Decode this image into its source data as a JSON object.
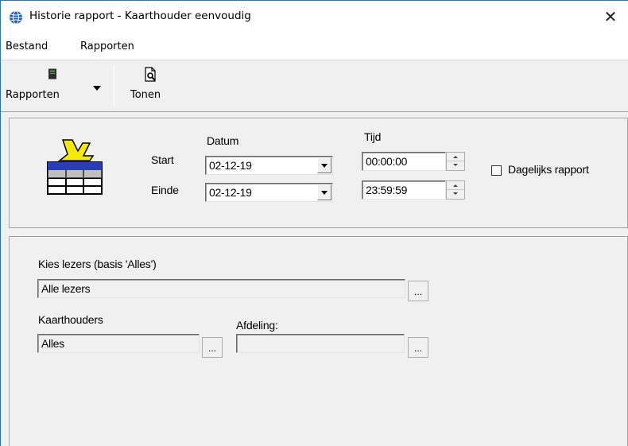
{
  "window": {
    "title": "Historie rapport - Kaarthouder eenvoudig",
    "close_glyph": "✕",
    "accent_color": "#2b73c8"
  },
  "menu": {
    "items": [
      "Bestand",
      "Rapporten"
    ]
  },
  "toolbar": {
    "reports_label": "Rapporten",
    "show_label": "Tonen"
  },
  "period": {
    "date_header": "Datum",
    "time_header": "Tijd",
    "start_label": "Start",
    "end_label": "Einde",
    "start_date": "02-12-19",
    "end_date": "02-12-19",
    "start_time": "00:00:00",
    "end_time": "23:59:59",
    "daily_report_label": "Dagelijks rapport",
    "daily_report_checked": false
  },
  "selection": {
    "readers_label": "Kies lezers (basis 'Alles')",
    "readers_value": "Alle lezers",
    "cardholders_label": "Kaarthouders",
    "cardholders_value": "Alles",
    "department_label": "Afdeling:",
    "department_value": "",
    "browse_label": "..."
  }
}
